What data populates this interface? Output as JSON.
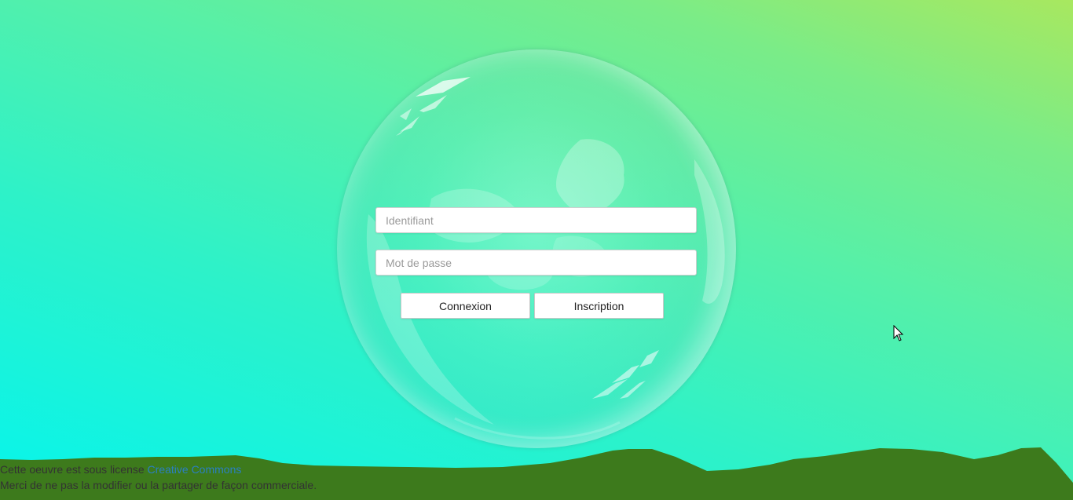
{
  "login_form": {
    "username_placeholder": "Identifiant",
    "password_placeholder": "Mot de passe",
    "connect_label": "Connexion",
    "signup_label": "Inscription"
  },
  "footer": {
    "license_prefix": "Cette oeuvre est sous license ",
    "license_link": "Creative Commons",
    "notice": "Merci de ne pas la modifier ou la partager de façon commerciale."
  },
  "colors": {
    "background_top_right": "#a8e85f",
    "background_bottom_left": "#06f4ec",
    "hills": "#3d7a1c",
    "link": "#2a7fc4"
  },
  "icons": {
    "cursor": "mouse-pointer-icon"
  }
}
